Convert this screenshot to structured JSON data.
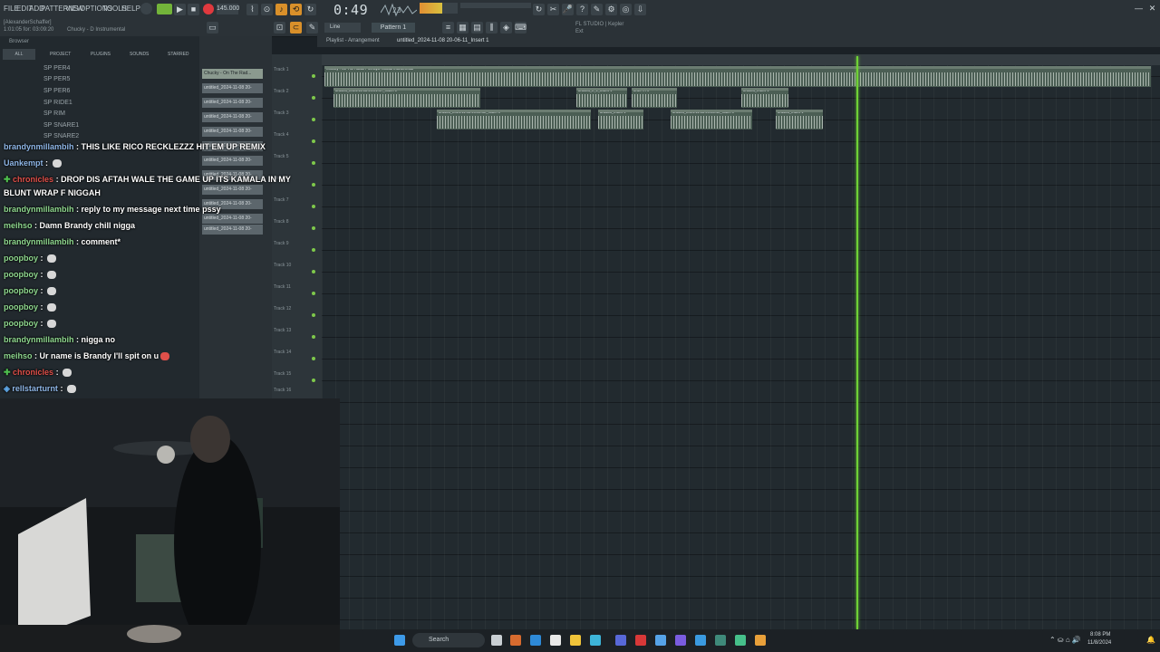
{
  "menu": [
    "FILE",
    "EDIT",
    "ADD",
    "PATTERNS",
    "VIEW",
    "OPTIONS",
    "TOOLS",
    "HELP"
  ],
  "transport": {
    "tempo": "145.000",
    "time": "0:49",
    "time_frac": "23",
    "pattern": "Pattern 1",
    "snap": "Line"
  },
  "hint_bar": {
    "line1": "[AlexanderSchaffer]",
    "line2": "1:01:05 for: 03:09:20",
    "project": "Chucky - D Instrumental"
  },
  "studio": {
    "name": "FL STUDIO | Kepler",
    "sub": "Ext"
  },
  "browser": {
    "title": "Browser",
    "tabs": [
      "ALL",
      "PROJECT",
      "PLUGINS",
      "SOUNDS",
      "STARRED"
    ],
    "items": [
      "SP PER4",
      "SP PER5",
      "SP PER6",
      "SP RIDE1",
      "SP RIM",
      "SP SNARE1",
      "SP SNARE2"
    ]
  },
  "patterns": [
    "Chucky - On The Rad...",
    "untitled_2024-11-08 20-",
    "untitled_2024-11-08 20-",
    "untitled_2024-11-08 20-",
    "untitled_2024-11-08 20-",
    "untitled_2024-11-08 20-",
    "untitled_2024-11-08 20-",
    "untitled_2024-11-08 20-",
    "untitled_2024-11-08 20-",
    "untitled_2024-11-08 20-",
    "untitled_2024-11-08 20-",
    "untitled_2024-11-08 20-"
  ],
  "playlist": {
    "title": "Playlist - Arrangement",
    "name": "untitled_2024-11-08 20-06-11_Insert 1",
    "tracks": [
      "Track 1",
      "Track 2",
      "Track 3",
      "Track 4",
      "Track 5",
      "Track 6",
      "Track 7",
      "Track 8",
      "Track 9",
      "Track 10",
      "Track 11",
      "Track 12",
      "Track 13",
      "Track 14",
      "Track 15",
      "Track 16"
    ],
    "clip_main": "Chucky - On The Radar Freestyle Official Instrumental",
    "clip_t2": [
      "untitled_2024-11-08 20-01-47_Insert 1",
      "untitled_2_1_Insert 1",
      "untit...H 1",
      "untitled_Insert 1"
    ],
    "clip_t3": [
      "untitled_2024-11-08 20-02-02_Insert 1",
      "untitled_Insert 1",
      "untitled_2024-11-08 20-06-40_Insert 1",
      "untitled_Insert 1"
    ]
  },
  "chat": [
    {
      "user": "brandynmillambih",
      "msg": " : THIS LIKE RICO RECKLEZZZ HIT EM UP REMIX"
    },
    {
      "user": "Uankempt",
      "msg": " : "
    },
    {
      "user": "chronicles",
      "msg": " : DROP DIS AFTAH WALE THE GAME UP ITS KAMALA IN MY"
    },
    {
      "user": "",
      "msg": "BLUNT WRAP F NIGGAH"
    },
    {
      "user": "brandynmillambih",
      "msg": " : reply to my message next time pssy"
    },
    {
      "user": "meihso",
      "msg": " : Damn Brandy chill nigga"
    },
    {
      "user": "brandynmillambih",
      "msg": " : comment*"
    },
    {
      "user": "poopboy",
      "msg": " : "
    },
    {
      "user": "poopboy",
      "msg": " : "
    },
    {
      "user": "poopboy",
      "msg": " : "
    },
    {
      "user": "poopboy",
      "msg": " : "
    },
    {
      "user": "poopboy",
      "msg": " : "
    },
    {
      "user": "brandynmillambih",
      "msg": " : nigga no"
    },
    {
      "user": "meihso",
      "msg": " : Ur name is Brandy I'll spit on u"
    },
    {
      "user": "chronicles",
      "msg": " : "
    },
    {
      "user": "rellstarturnt",
      "msg": " : "
    }
  ],
  "taskbar": {
    "search": "Search",
    "time": "8:08 PM",
    "date": "11/8/2024"
  },
  "colors": {
    "playhead": "#6fd136",
    "clip": "#4b5e54",
    "record": "#e0393e"
  }
}
